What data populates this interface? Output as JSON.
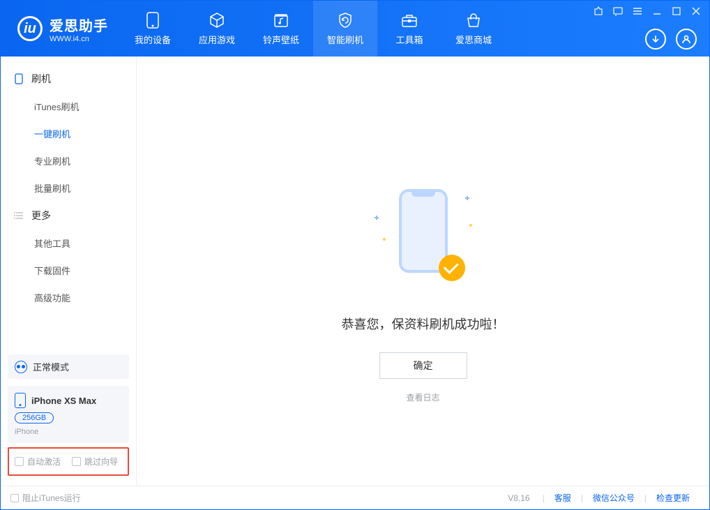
{
  "app": {
    "name": "爱思助手",
    "site": "WWW.i4.cn"
  },
  "nav": [
    {
      "label": "我的设备",
      "icon": "device-icon"
    },
    {
      "label": "应用游戏",
      "icon": "cube-icon"
    },
    {
      "label": "铃声壁纸",
      "icon": "music-folder-icon"
    },
    {
      "label": "智能刷机",
      "icon": "refresh-shield-icon",
      "active": true
    },
    {
      "label": "工具箱",
      "icon": "toolbox-icon"
    },
    {
      "label": "爱思商城",
      "icon": "store-icon"
    }
  ],
  "sidebar": {
    "group1": {
      "title": "刷机",
      "items": [
        "iTunes刷机",
        "一键刷机",
        "专业刷机",
        "批量刷机"
      ],
      "activeIndex": 1
    },
    "group2": {
      "title": "更多",
      "items": [
        "其他工具",
        "下载固件",
        "高级功能"
      ]
    },
    "mode": "正常模式",
    "device": {
      "name": "iPhone XS Max",
      "capacity": "256GB",
      "type": "iPhone"
    },
    "checks": {
      "auto_activate": "自动激活",
      "skip_guide": "跳过向导"
    }
  },
  "main": {
    "success_text": "恭喜您，保资料刷机成功啦！",
    "ok_button": "确定",
    "view_log": "查看日志"
  },
  "footer": {
    "block_itunes": "阻止iTunes运行",
    "version": "V8.16",
    "links": [
      "客服",
      "微信公众号",
      "检查更新"
    ]
  }
}
